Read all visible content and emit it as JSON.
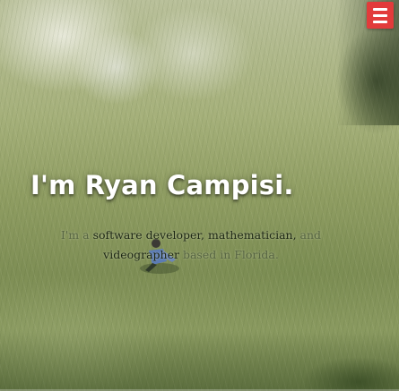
{
  "header": {
    "menu_icon": "hamburger-menu-icon",
    "menu_color": "#e23b3b"
  },
  "hero": {
    "title": "I'm Ryan Campisi.",
    "subtitle_part1": "I'm a",
    "subtitle_part2": "software developer, mathematician,",
    "subtitle_part3": "and",
    "subtitle_part4": "videographer",
    "subtitle_part5": "based in Florida."
  }
}
